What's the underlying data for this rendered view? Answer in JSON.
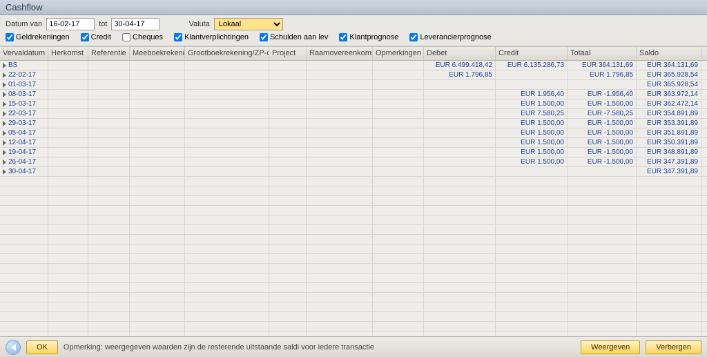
{
  "title": "Cashflow",
  "filters": {
    "date_from_label": "Datum van",
    "date_from": "16-02-17",
    "to_label": "tot",
    "date_to": "30-04-17",
    "currency_label": "Valuta",
    "currency_value": "Lokaal",
    "cb_geldrekeningen": "Geldrekeningen",
    "cb_credit": "Credit",
    "cb_cheques": "Cheques",
    "cb_klantverplichtingen": "Klantverplichtingen",
    "cb_schulden": "Schulden aan lev",
    "cb_klantprognose": "Klantprognose",
    "cb_leverancierprognose": "Leverancierprognose"
  },
  "headers": {
    "c0": "Vervaldatum",
    "c1": "Herkomst",
    "c2": "Referentie",
    "c3": "Meeboekrekening",
    "c4": "Grootboekrekening/ZP-code",
    "c5": "Project",
    "c6": "Raamovereenkomst",
    "c7": "Opmerkingen",
    "c8": "Debet",
    "c9": "Credit",
    "c10": "Totaal",
    "c11": "Saldo"
  },
  "rows": [
    {
      "d": "BS",
      "debet": "EUR 6.499.418,42",
      "credit": "EUR 6.135.286,73",
      "totaal": "EUR 364.131,69",
      "saldo": "EUR 364.131,69"
    },
    {
      "d": "22-02-17",
      "debet": "EUR 1.796,85",
      "credit": "",
      "totaal": "EUR 1.796,85",
      "saldo": "EUR 365.928,54"
    },
    {
      "d": "01-03-17",
      "debet": "",
      "credit": "",
      "totaal": "",
      "saldo": "EUR 365.928,54"
    },
    {
      "d": "08-03-17",
      "debet": "",
      "credit": "EUR 1.956,40",
      "totaal": "EUR -1.956,40",
      "saldo": "EUR 363.972,14"
    },
    {
      "d": "15-03-17",
      "debet": "",
      "credit": "EUR 1.500,00",
      "totaal": "EUR -1.500,00",
      "saldo": "EUR 362.472,14"
    },
    {
      "d": "22-03-17",
      "debet": "",
      "credit": "EUR 7.580,25",
      "totaal": "EUR -7.580,25",
      "saldo": "EUR 354.891,89"
    },
    {
      "d": "29-03-17",
      "debet": "",
      "credit": "EUR 1.500,00",
      "totaal": "EUR -1.500,00",
      "saldo": "EUR 353.391,89"
    },
    {
      "d": "05-04-17",
      "debet": "",
      "credit": "EUR 1.500,00",
      "totaal": "EUR -1.500,00",
      "saldo": "EUR 351.891,89"
    },
    {
      "d": "12-04-17",
      "debet": "",
      "credit": "EUR 1.500,00",
      "totaal": "EUR -1.500,00",
      "saldo": "EUR 350.391,89"
    },
    {
      "d": "19-04-17",
      "debet": "",
      "credit": "EUR 1.500,00",
      "totaal": "EUR -1.500,00",
      "saldo": "EUR 348.891,89"
    },
    {
      "d": "26-04-17",
      "debet": "",
      "credit": "EUR 1.500,00",
      "totaal": "EUR -1.500,00",
      "saldo": "EUR 347.391,89"
    },
    {
      "d": "30-04-17",
      "debet": "",
      "credit": "",
      "totaal": "",
      "saldo": "EUR 347.391,89"
    }
  ],
  "footer": {
    "ok": "OK",
    "note": "Opmerking: weergegeven waarden zijn de resterende uitstaande saldi voor iedere transactie",
    "weergeven": "Weergeven",
    "verbergen": "Verbergen"
  }
}
